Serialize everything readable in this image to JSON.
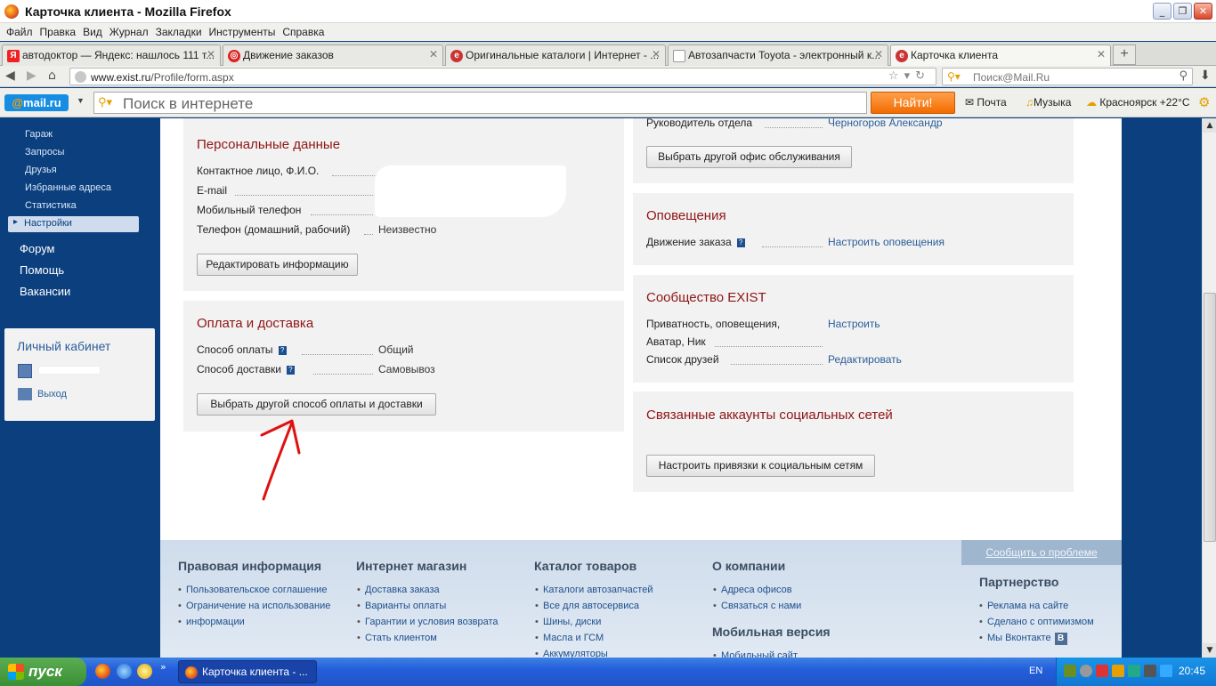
{
  "window": {
    "title": "Карточка клиента - Mozilla Firefox",
    "buttons": [
      "_",
      "❐",
      "✕"
    ]
  },
  "menu": [
    "Файл",
    "Правка",
    "Вид",
    "Журнал",
    "Закладки",
    "Инструменты",
    "Справка"
  ],
  "tabs": [
    {
      "label": "автодоктор — Яндекс: нашлось 111 т...",
      "icon": "Я"
    },
    {
      "label": "Движение заказов",
      "icon": "◎"
    },
    {
      "label": "Оригинальные каталоги | Интернет - ...",
      "icon": "e"
    },
    {
      "label": "Автозапчасти Toyota - электронный к...",
      "icon": ""
    },
    {
      "label": "Карточка клиента",
      "icon": "e"
    }
  ],
  "nav": {
    "url_prefix": "www.exist.ru",
    "url_path": "/Profile/form.aspx",
    "search_placeholder": "Поиск@Mail.Ru"
  },
  "mailru": {
    "logo_at": "@",
    "logo_text": "mail.ru",
    "search_placeholder": "Поиск в интернете",
    "find_button": "Найти!",
    "mail": "Почта",
    "music": "Музыка",
    "weather": "Красноярск +22°C"
  },
  "sidebar": {
    "items": [
      "Гараж",
      "Запросы",
      "Друзья",
      "Избранные адреса",
      "Статистика",
      "Настройки"
    ],
    "big_links": [
      "Форум",
      "Помощь",
      "Вакансии"
    ],
    "cabinet_title": "Личный кабинет",
    "exit": "Выход"
  },
  "personal": {
    "title": "Персональные данные",
    "rows": [
      {
        "label": "Контактное лицо, Ф.И.О.",
        "value": ""
      },
      {
        "label": "E-mail",
        "value": ""
      },
      {
        "label": "Мобильный телефон",
        "value": ""
      },
      {
        "label": "Телефон (домашний, рабочий)",
        "value": "Неизвестно"
      }
    ],
    "edit_button": "Редактировать информацию"
  },
  "payment": {
    "title": "Оплата и доставка",
    "rows": [
      {
        "label": "Способ оплаты",
        "value": "Общий"
      },
      {
        "label": "Способ доставки",
        "value": "Самовывоз"
      }
    ],
    "button": "Выбрать другой способ оплаты и доставки"
  },
  "office": {
    "manager_label": "Руководитель отдела",
    "manager_value": "Черногоров Александр",
    "button": "Выбрать другой офис обслуживания"
  },
  "notifications": {
    "title": "Оповещения",
    "row_label": "Движение заказа",
    "row_link": "Настроить оповещения"
  },
  "community": {
    "title": "Сообщество EXIST",
    "row1_label_a": "Приватность, оповещения,",
    "row1_label_b": "Аватар, Ник",
    "row1_link": "Настроить",
    "row2_label": "Список друзей",
    "row2_link": "Редактировать"
  },
  "social": {
    "title": "Связанные аккаунты социальных сетей",
    "button": "Настроить привязки к социальным сетям"
  },
  "footer": {
    "report": "Сообщить о проблеме",
    "legal_title": "Правовая информация",
    "legal": [
      "Пользовательское соглашение",
      "Ограничение на использование",
      "информации"
    ],
    "shop_title": "Интернет магазин",
    "shop": [
      "Доставка заказа",
      "Варианты оплаты",
      "Гарантии и условия возврата",
      "Стать клиентом"
    ],
    "catalog_title": "Каталог товаров",
    "catalog": [
      "Каталоги автозапчастей",
      "Все для автосервиса",
      "Шины, диски",
      "Масла и ГСМ",
      "Аккумуляторы"
    ],
    "company_title": "О компании",
    "company": [
      "Адреса офисов",
      "Связаться с нами"
    ],
    "mobile_title": "Мобильная версия",
    "mobile": [
      "Мобильный сайт"
    ],
    "partner_title": "Партнерство",
    "partner": [
      "Реклама на сайте",
      "Сделано с оптимизмом",
      "Мы Вконтакте"
    ],
    "vk_badge": "В"
  },
  "taskbar": {
    "start": "пуск",
    "task": "Карточка клиента - ...",
    "lang": "EN",
    "clock": "20:45"
  }
}
